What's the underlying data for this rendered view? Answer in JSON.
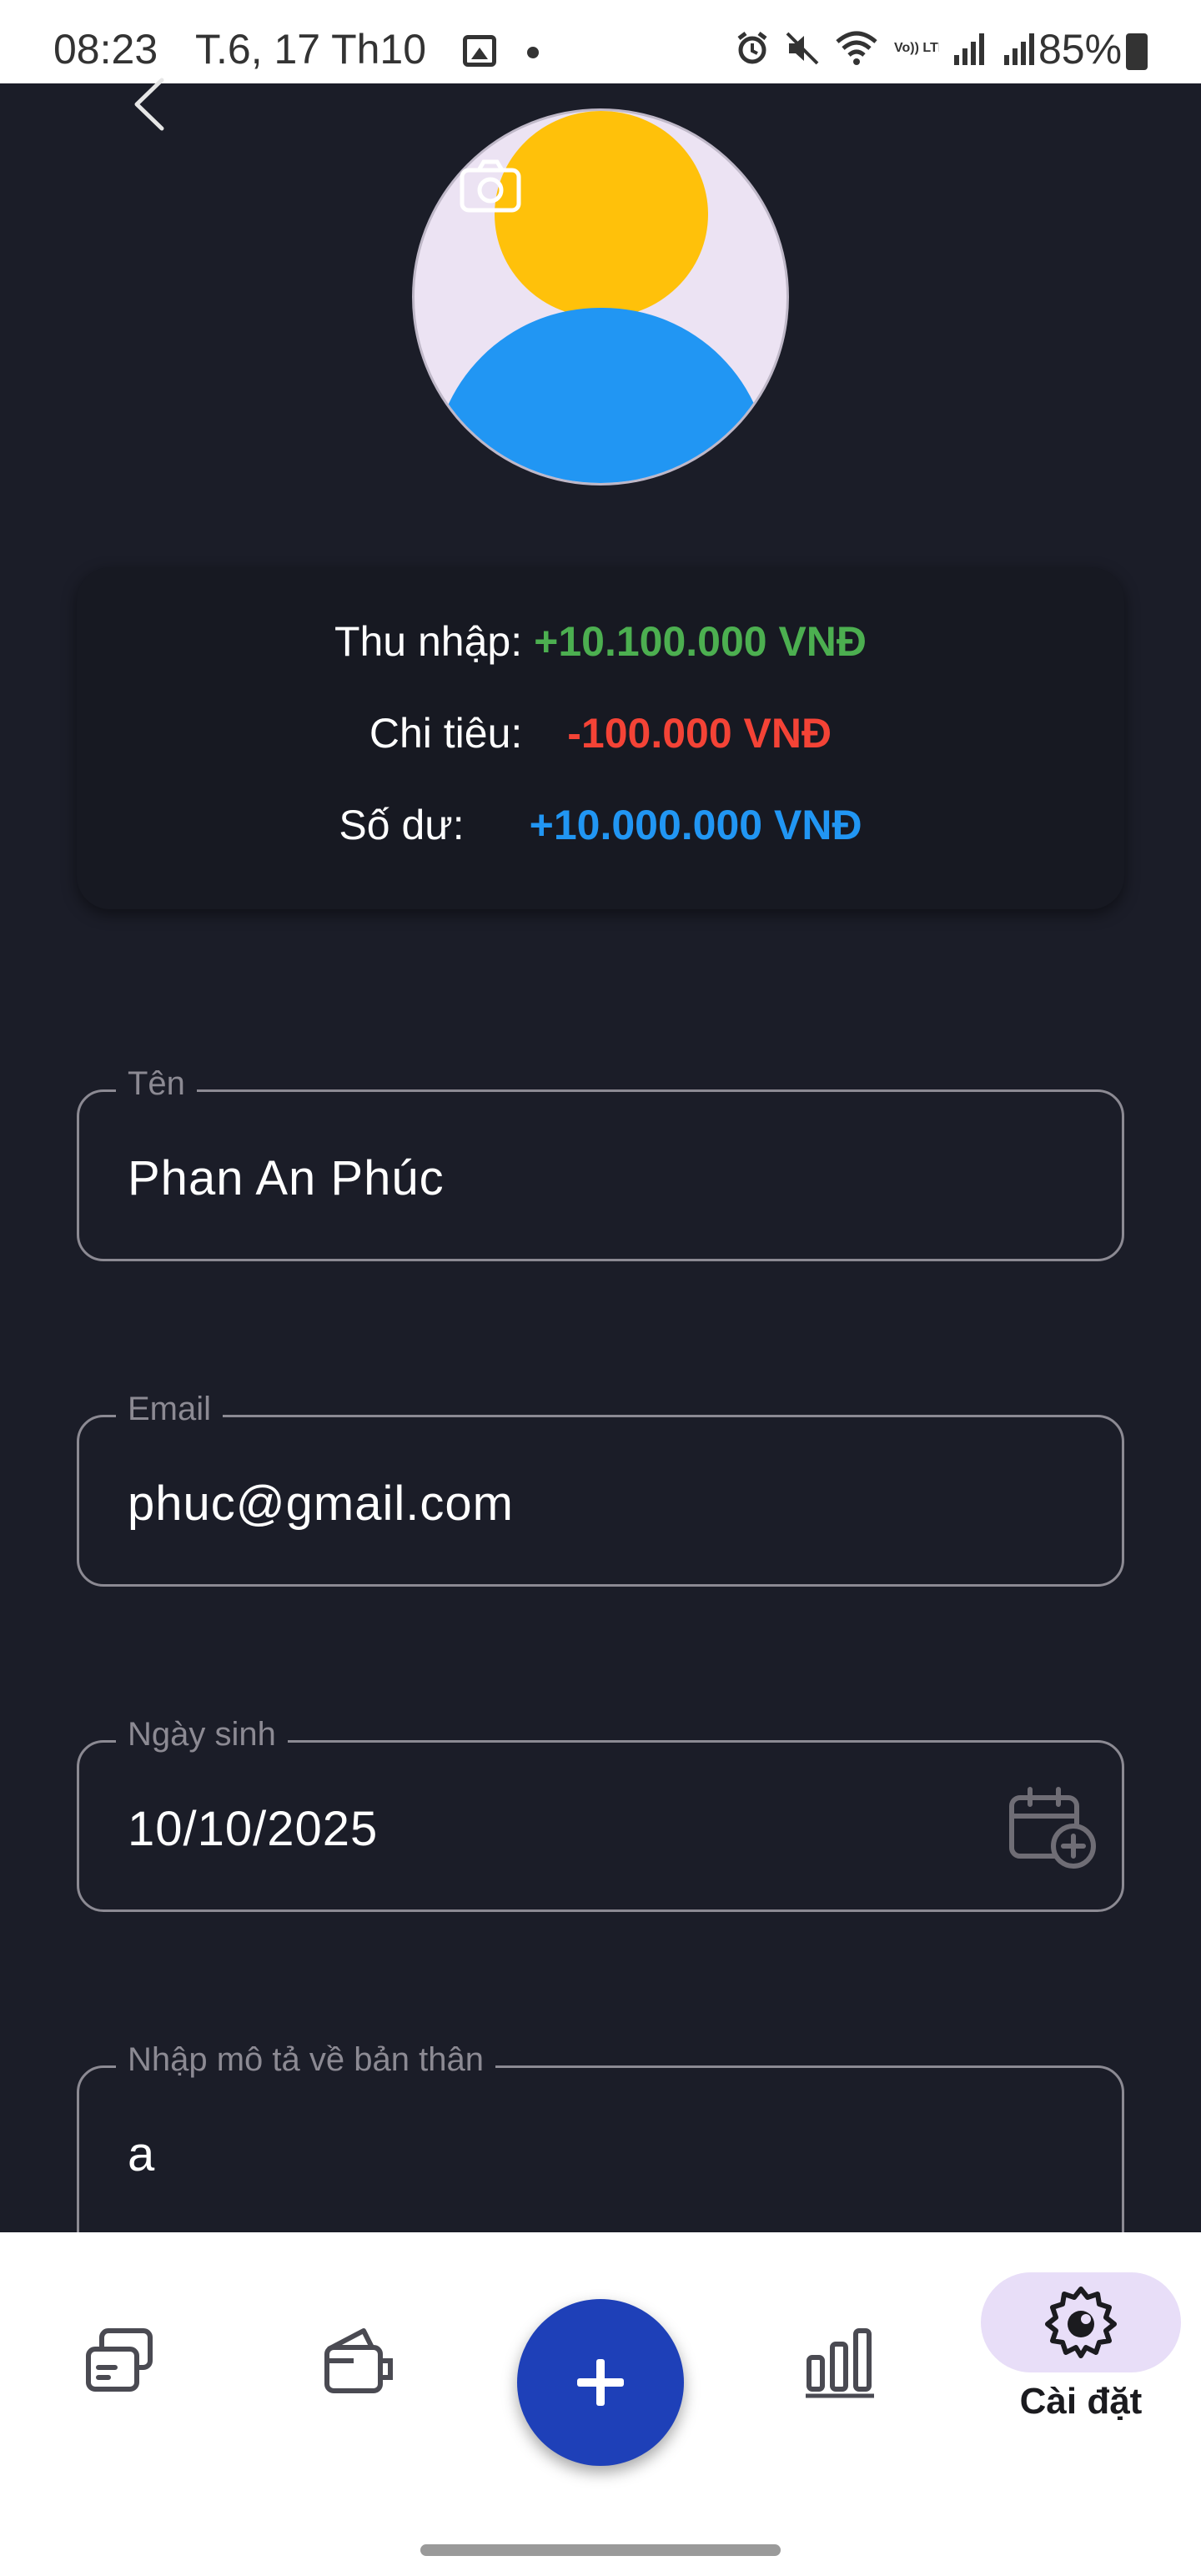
{
  "status_bar": {
    "time": "08:23",
    "date": "T.6, 17 Th10",
    "battery": "85%",
    "network_label": "Vo)) LTE1"
  },
  "summary": {
    "income_label": "Thu nhập:",
    "income_value": "+10.100.000 VNĐ",
    "income_color": "#4caf50",
    "expense_label": "Chi tiêu:",
    "expense_value": "-100.000 VNĐ",
    "expense_color": "#f44336",
    "balance_label": "Số dư:",
    "balance_value": "+10.000.000 VNĐ",
    "balance_color": "#2196f3"
  },
  "form": {
    "name_label": "Tên",
    "name_value": "Phan An Phúc",
    "email_label": "Email",
    "email_value": "phuc@gmail.com",
    "birthday_label": "Ngày sinh",
    "birthday_value": "10/10/2025",
    "bio_label": "Nhập mô tả về bản thân",
    "bio_value": "a"
  },
  "nav": {
    "settings_label": "Cài đặt"
  },
  "icons": {
    "back": "chevron-left-icon",
    "camera": "camera-icon",
    "calendar": "calendar-add-icon",
    "transactions": "cards-icon",
    "wallet": "wallet-icon",
    "add": "plus-icon",
    "stats": "bar-chart-icon",
    "settings": "gear-icon"
  }
}
